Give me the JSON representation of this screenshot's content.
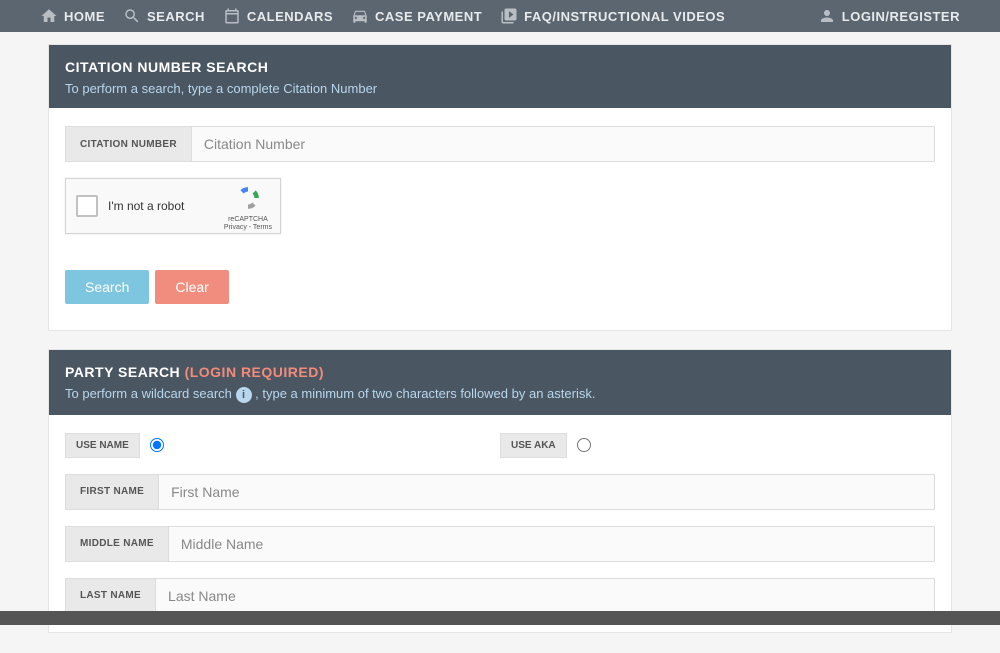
{
  "nav": {
    "home": "HOME",
    "search": "SEARCH",
    "calendars": "CALENDARS",
    "case_payment": "CASE PAYMENT",
    "faq": "FAQ/INSTRUCTIONAL VIDEOS",
    "login": "LOGIN/REGISTER"
  },
  "citation": {
    "title": "CITATION NUMBER SEARCH",
    "desc": "To perform a search, type a complete Citation Number",
    "field_label": "CITATION NUMBER",
    "placeholder": "Citation Number"
  },
  "recaptcha": {
    "text": "I'm not a robot",
    "brand": "reCAPTCHA",
    "legal": "Privacy - Terms"
  },
  "buttons": {
    "search": "Search",
    "clear": "Clear"
  },
  "party": {
    "title": "PARTY SEARCH",
    "login_req": "(LOGIN REQUIRED)",
    "desc_pre": "To perform a wildcard search ",
    "desc_post": " , type a minimum of two characters followed by an asterisk.",
    "use_name": "USE NAME",
    "use_aka": "USE AKA",
    "first_label": "FIRST NAME",
    "first_ph": "First Name",
    "middle_label": "MIDDLE NAME",
    "middle_ph": "Middle Name",
    "last_label": "LAST NAME",
    "last_ph": "Last Name"
  }
}
